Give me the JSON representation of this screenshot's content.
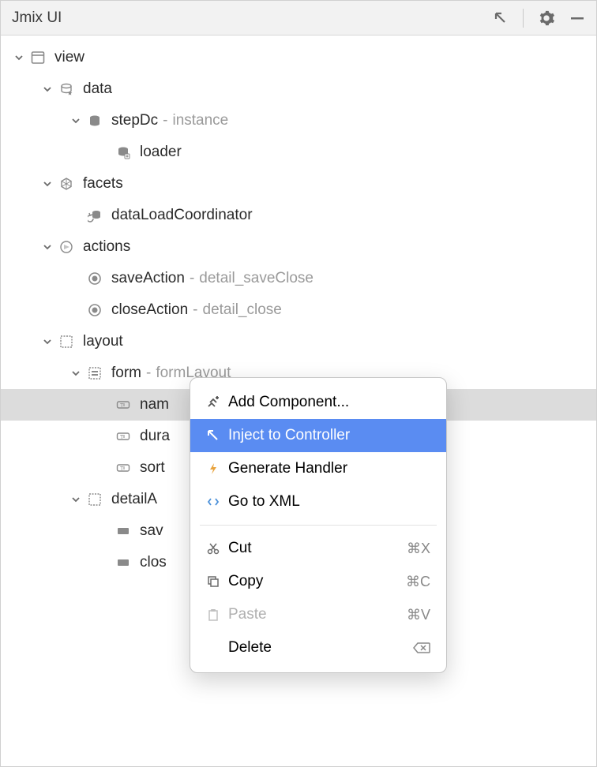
{
  "panel": {
    "title": "Jmix UI"
  },
  "tree": {
    "view": {
      "label": "view"
    },
    "data": {
      "label": "data"
    },
    "stepDc": {
      "label": "stepDc",
      "suffix": "instance"
    },
    "loader": {
      "label": "loader"
    },
    "facets": {
      "label": "facets"
    },
    "dataLoadCoordinator": {
      "label": "dataLoadCoordinator"
    },
    "actions": {
      "label": "actions"
    },
    "saveAction": {
      "label": "saveAction",
      "suffix": "detail_saveClose"
    },
    "closeAction": {
      "label": "closeAction",
      "suffix": "detail_close"
    },
    "layout": {
      "label": "layout"
    },
    "form": {
      "label": "form",
      "suffix": "formLayout"
    },
    "nameField": {
      "label": "nam"
    },
    "durationField": {
      "label": "dura"
    },
    "sortField": {
      "label": "sort"
    },
    "detailActions": {
      "label": "detailA"
    },
    "save": {
      "label": "sav"
    },
    "close": {
      "label": "clos"
    }
  },
  "menu": {
    "addComponent": "Add Component...",
    "injectToController": "Inject to Controller",
    "generateHandler": "Generate Handler",
    "goToXml": "Go to XML",
    "cut": "Cut",
    "cutShortcut": "⌘X",
    "copy": "Copy",
    "copyShortcut": "⌘C",
    "paste": "Paste",
    "pasteShortcut": "⌘V",
    "delete": "Delete"
  }
}
